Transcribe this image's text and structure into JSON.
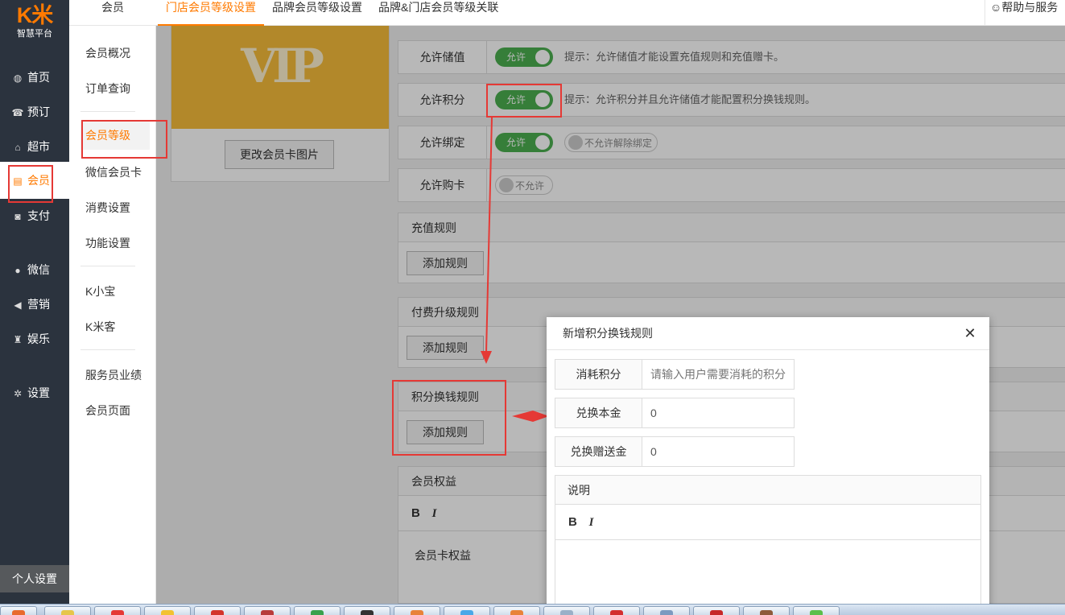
{
  "logo": {
    "mark": "K米",
    "subtitle": "智慧平台"
  },
  "nav": [
    {
      "label": "首页",
      "icon": "dashboard-icon",
      "glyph": "◍"
    },
    {
      "label": "预订",
      "icon": "phone-icon",
      "glyph": "☎"
    },
    {
      "label": "超市",
      "icon": "basket-icon",
      "glyph": "⌂"
    },
    {
      "label": "会员",
      "icon": "card-icon",
      "glyph": "▤"
    },
    {
      "label": "支付",
      "icon": "money-icon",
      "glyph": "◙"
    },
    {
      "label": "微信",
      "icon": "wechat-icon",
      "glyph": "●"
    },
    {
      "label": "营销",
      "icon": "megaphone-icon",
      "glyph": "◀"
    },
    {
      "label": "娱乐",
      "icon": "entertainment-icon",
      "glyph": "♜"
    },
    {
      "label": "设置",
      "icon": "gear-icon",
      "glyph": "✲"
    }
  ],
  "personal_settings": "个人设置",
  "topbar": {
    "tabs": [
      "会员",
      "门店会员等级设置",
      "品牌会员等级设置",
      "品牌&门店会员等级关联"
    ],
    "help": "帮助与服务",
    "help_glyph": "☺"
  },
  "subnav": {
    "items": [
      "会员概况",
      "订单查询",
      "会员等级",
      "微信会员卡",
      "消费设置",
      "功能设置",
      "K小宝",
      "K米客",
      "服务员业绩",
      "会员页面"
    ],
    "active": "会员等级"
  },
  "vip_card": {
    "logo_text": "VIP",
    "change_button": "更改会员卡图片"
  },
  "settings": {
    "stored_value": {
      "label": "允许储值",
      "toggle": "允许",
      "hint": "提示：允许储值才能设置充值规则和充值赠卡。"
    },
    "points": {
      "label": "允许积分",
      "toggle": "允许",
      "hint": "提示：允许积分并且允许储值才能配置积分换钱规则。"
    },
    "binding": {
      "label": "允许绑定",
      "toggle": "允许",
      "unbind_toggle": "不允许解除绑定"
    },
    "buy_card": {
      "label": "允许购卡",
      "toggle": "不允许"
    }
  },
  "panels": {
    "recharge": {
      "title": "充值规则",
      "button": "添加规则"
    },
    "paid_upgrade": {
      "title": "付费升级规则",
      "button": "添加规则"
    },
    "points_exchange": {
      "title": "积分换钱规则",
      "button": "添加规则"
    },
    "benefits": {
      "title": "会员权益",
      "content": "会员卡权益"
    }
  },
  "editor": {
    "bold": "B",
    "italic": "I"
  },
  "modal": {
    "title": "新增积分换钱规则",
    "close": "✕",
    "fields": {
      "points": {
        "label": "消耗积分",
        "placeholder": "请输入用户需要消耗的积分"
      },
      "principal": {
        "label": "兑换本金",
        "value": "0"
      },
      "bonus": {
        "label": "兑换赠送金",
        "value": "0"
      }
    },
    "description_label": "说明"
  },
  "colors": {
    "accent": "#ff7a00",
    "nav_bg": "#2b333e",
    "toggle_on": "#4caf50",
    "highlight": "#e53935"
  }
}
